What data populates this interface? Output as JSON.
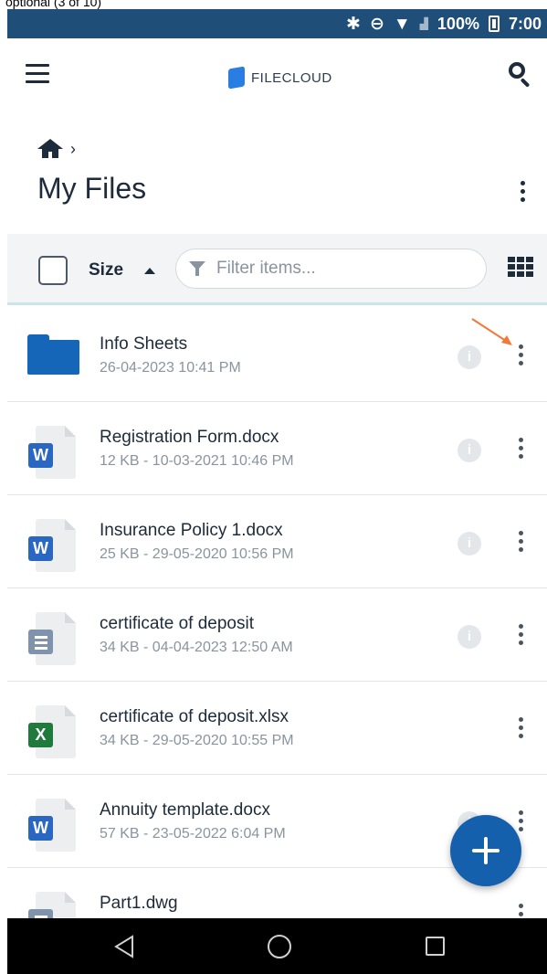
{
  "crop_text": "optional (3 of 10)",
  "status_bar": {
    "battery": "100%",
    "time": "7:00"
  },
  "app_bar": {
    "logo_text": "FILECLOUD"
  },
  "breadcrumb": {
    "separator": "›"
  },
  "page_title": "My Files",
  "toolbar": {
    "sort_label": "Size",
    "sort_direction": "ascending",
    "filter_placeholder": "Filter items..."
  },
  "files": [
    {
      "name": "Info Sheets",
      "meta": "26-04-2023 10:41 PM",
      "type": "folder-icon"
    },
    {
      "name": "Registration Form.docx",
      "meta": "12 KB - 10-03-2021 10:46 PM",
      "type": "word-file-icon",
      "badge": "W"
    },
    {
      "name": "Insurance Policy 1.docx",
      "meta": "25 KB - 29-05-2020 10:56 PM",
      "type": "word-file-icon",
      "badge": "W"
    },
    {
      "name": "certificate of deposit",
      "meta": "34 KB - 04-04-2023 12:50 AM",
      "type": "text-file-icon"
    },
    {
      "name": "certificate of deposit.xlsx",
      "meta": "34 KB - 29-05-2020 10:55 PM",
      "type": "excel-file-icon",
      "badge": "X"
    },
    {
      "name": "Annuity template.docx",
      "meta": "57 KB - 23-05-2022 6:04 PM",
      "type": "word-file-icon",
      "badge": "W"
    },
    {
      "name": "Part1.dwg",
      "meta": "",
      "type": "text-file-icon"
    }
  ],
  "info_glyph": "i",
  "colors": {
    "status_bar": "#1f4e79",
    "accent": "#1560ad",
    "folder": "#1565b8",
    "word": "#2a67c2",
    "excel": "#1f7a3c",
    "annotation_arrow": "#f07a3a"
  }
}
